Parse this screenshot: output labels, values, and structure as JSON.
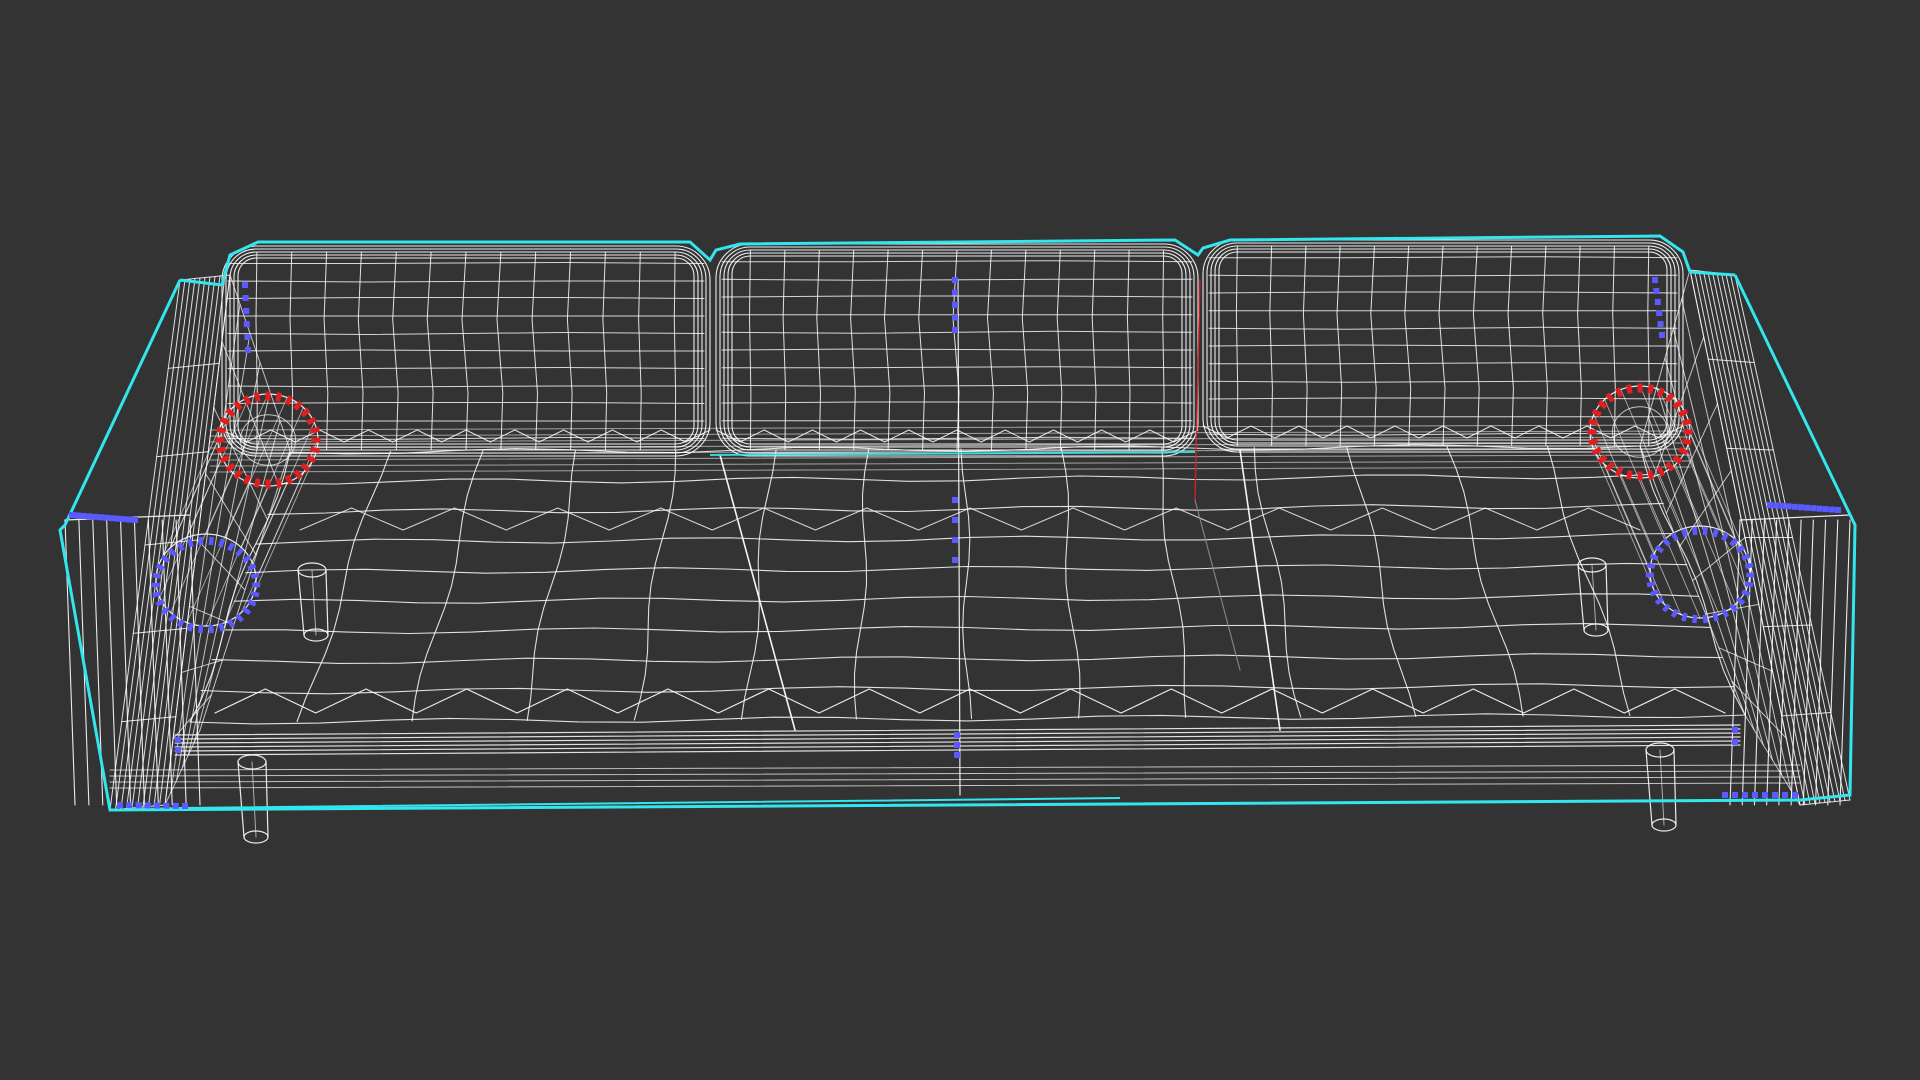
{
  "viewport": {
    "background": "#333333",
    "shading_mode": "wireframe",
    "object": "sofa",
    "colors": {
      "outline": "#33e6ee",
      "wire": "#ffffff",
      "vertex_selected": "#5a5aff",
      "vertex_active": "#e02020"
    }
  }
}
